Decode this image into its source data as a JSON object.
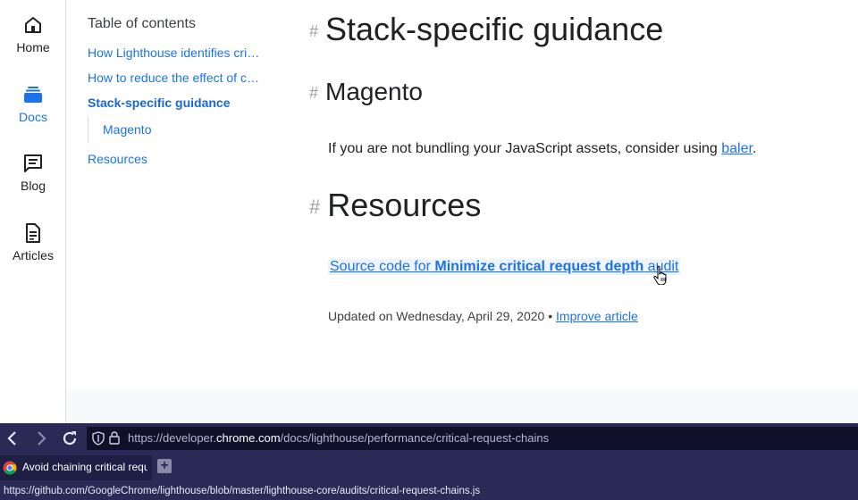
{
  "rail": {
    "items": [
      {
        "label": "Home",
        "icon": "home-icon"
      },
      {
        "label": "Docs",
        "icon": "docs-icon",
        "active": true
      },
      {
        "label": "Blog",
        "icon": "blog-icon"
      },
      {
        "label": "Articles",
        "icon": "articles-icon"
      }
    ]
  },
  "toc": {
    "title": "Table of contents",
    "items": [
      "How Lighthouse identifies critical request chains",
      "How to reduce the effect of critical request chains on load times",
      "Stack-specific guidance",
      "Magento",
      "Resources"
    ]
  },
  "main": {
    "hash": "#",
    "h1": "Stack-specific guidance",
    "h2_magento": "Magento",
    "para_text": "If you are not bundling your JavaScript assets, consider using ",
    "para_link": "baler",
    "para_end": ".",
    "h2_resources": "Resources",
    "source_link_prefix": "Source code for ",
    "source_link_bold": "Minimize critical request depth",
    "source_link_suffix": " audit",
    "updated_text": "Updated on Wednesday, April 29, 2020 • ",
    "improve_link": "Improve article"
  },
  "browser": {
    "url_prefix": "https://developer.",
    "url_domain": "chrome.com",
    "url_path": "/docs/lighthouse/performance/critical-request-chains",
    "tab_title": "Avoid chaining critical requests",
    "new_tab": "+",
    "status_url": "https://github.com/GoogleChrome/lighthouse/blob/master/lighthouse-core/audits/critical-request-chains.js"
  },
  "colors": {
    "link": "#1a73e8",
    "browser_bg": "#2b2a57",
    "url_field_bg": "#10102a"
  }
}
